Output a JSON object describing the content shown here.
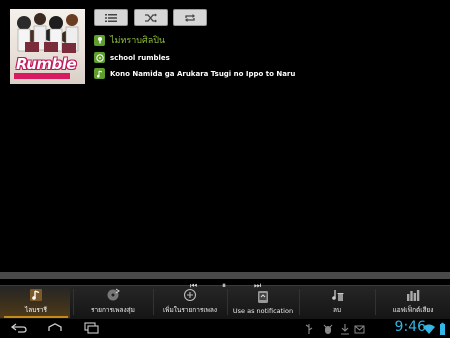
{
  "album": {
    "logo_text": "Rumble"
  },
  "controls": [
    {
      "name": "queue-list-button",
      "icon": "list-icon"
    },
    {
      "name": "shuffle-button",
      "icon": "shuffle-icon"
    },
    {
      "name": "repeat-button",
      "icon": "repeat-icon"
    }
  ],
  "track_info": {
    "artist": "ไม่ทราบศิลปิน",
    "album": "school rumbles",
    "title": "Kono Namida ga Arukara Tsugi no Ippo to Naru"
  },
  "playback": {
    "progress": 0.0,
    "state": "playing"
  },
  "tabs": [
    {
      "label": "ไลบรารี",
      "icon": "music-library-icon",
      "active": true
    },
    {
      "label": "รายการเพลงสุ่ม",
      "icon": "party-shuffle-icon",
      "active": false
    },
    {
      "label": "เพิ่มในรายการเพลง",
      "icon": "add-to-playlist-icon",
      "active": false
    },
    {
      "label": "Use as notification",
      "icon": "notification-icon",
      "active": false
    },
    {
      "label": "ลบ",
      "icon": "delete-icon",
      "active": false
    },
    {
      "label": "แอฟเฟ็กต์เสียง",
      "icon": "equalizer-icon",
      "active": false
    }
  ],
  "system": {
    "clock": "9:46",
    "accent_color": "#33b5e5"
  }
}
